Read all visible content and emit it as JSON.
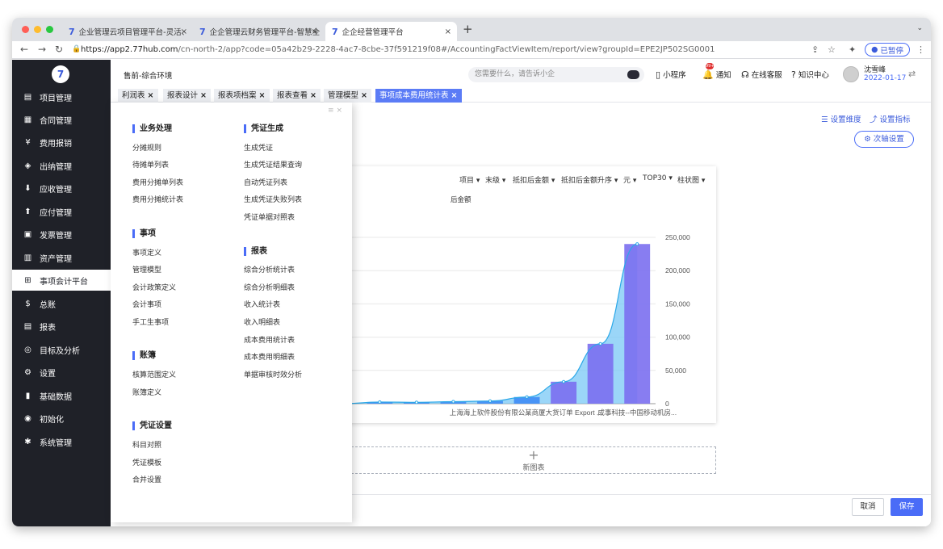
{
  "browser": {
    "tabs": [
      {
        "label": "企业管理云项目管理平台-灵活、"
      },
      {
        "label": "企企管理云财务管理平台-智慧全"
      },
      {
        "label": "企企经营管理平台"
      }
    ],
    "url_host": "https://app2.77hub.com",
    "url_path": "/cn-north-2/app?code=05a42b29-2228-4ac7-8cbe-37f591219f08#/AccountingFactViewItem/report/view?groupId=EPE2JP502SG0001",
    "paused_label": "已暂停"
  },
  "topbar": {
    "env": "售前-综合环境",
    "search_placeholder": "您需要什么，请告诉小企",
    "mini_program": "小程序",
    "notify": "通知",
    "notify_badge": "99+",
    "service": "在线客服",
    "knowledge": "知识中心",
    "user_name": "沈雪峰",
    "user_date": "2022-01-17"
  },
  "sidebar": {
    "items": [
      {
        "label": "项目管理",
        "icon": "folder-icon"
      },
      {
        "label": "合同管理",
        "icon": "contract-icon"
      },
      {
        "label": "费用报销",
        "icon": "expense-icon"
      },
      {
        "label": "出纳管理",
        "icon": "cashier-icon"
      },
      {
        "label": "应收管理",
        "icon": "receivable-icon"
      },
      {
        "label": "应付管理",
        "icon": "payable-icon"
      },
      {
        "label": "发票管理",
        "icon": "invoice-icon"
      },
      {
        "label": "资产管理",
        "icon": "asset-icon"
      },
      {
        "label": "事项会计平台",
        "icon": "grid-icon"
      },
      {
        "label": "总账",
        "icon": "ledger-icon"
      },
      {
        "label": "报表",
        "icon": "report-icon"
      },
      {
        "label": "目标及分析",
        "icon": "target-icon"
      },
      {
        "label": "设置",
        "icon": "gear-icon"
      },
      {
        "label": "基础数据",
        "icon": "bar-chart-icon"
      },
      {
        "label": "初始化",
        "icon": "init-icon"
      },
      {
        "label": "系统管理",
        "icon": "asterisk-icon"
      }
    ]
  },
  "page_tabs": [
    {
      "label": "利润表"
    },
    {
      "label": "报表设计"
    },
    {
      "label": "报表项档案"
    },
    {
      "label": "报表查看"
    },
    {
      "label": "管理模型"
    },
    {
      "label": "事项成本费用统计表"
    }
  ],
  "toolbar": {
    "set_dimension": "设置维度",
    "set_indicator": "设置指标",
    "secondary_axis": "次轴设置"
  },
  "chart_controls": [
    "项目",
    "末级",
    "抵扣后金额",
    "抵扣后金额升序",
    "元",
    "TOP30",
    "柱状图"
  ],
  "new_chart": "新图表",
  "footer": {
    "cancel": "取消",
    "save": "保存"
  },
  "menu": {
    "groups": [
      {
        "title": "业务处理",
        "items": [
          "分摊规则",
          "待摊单列表",
          "费用分摊单列表",
          "费用分摊统计表"
        ]
      },
      {
        "title": "事项",
        "items": [
          "事项定义",
          "管理模型",
          "会计政策定义",
          "会计事项",
          "手工生事项"
        ]
      },
      {
        "title": "账簿",
        "items": [
          "核算范围定义",
          "账簿定义"
        ]
      },
      {
        "title": "凭证设置",
        "items": [
          "科目对照",
          "凭证模板",
          "合并设置"
        ]
      },
      {
        "title": "凭证生成",
        "items": [
          "生成凭证",
          "生成凭证结果查询",
          "自动凭证列表",
          "生成凭证失败列表",
          "凭证单据对照表"
        ]
      },
      {
        "title": "报表",
        "items": [
          "综合分析统计表",
          "综合分析明细表",
          "收入统计表",
          "收入明细表",
          "成本费用统计表",
          "成本费用明细表",
          "单据审核时效分析"
        ]
      }
    ]
  },
  "chart_data": {
    "type": "bar",
    "series_label": "后金额",
    "categories": [
      "",
      "",
      "",
      "",
      "上海海上软件股份有限公...",
      "",
      "某商厦大货订单 Export ...",
      "",
      "成事科技--中国移动机房..."
    ],
    "values": [
      0,
      2500,
      2000,
      3000,
      4000,
      10000,
      33000,
      90000,
      240000
    ],
    "ylim": [
      0,
      250000
    ],
    "yticks": [
      0,
      50000,
      100000,
      150000,
      200000,
      250000
    ],
    "ytick_labels": [
      "0",
      "50,000",
      "100,000",
      "150,000",
      "200,000",
      "250,000"
    ],
    "bar_color": "#3f8cf5",
    "highlight_color": "#7b6ff0",
    "area_color": "#79c8f5"
  }
}
